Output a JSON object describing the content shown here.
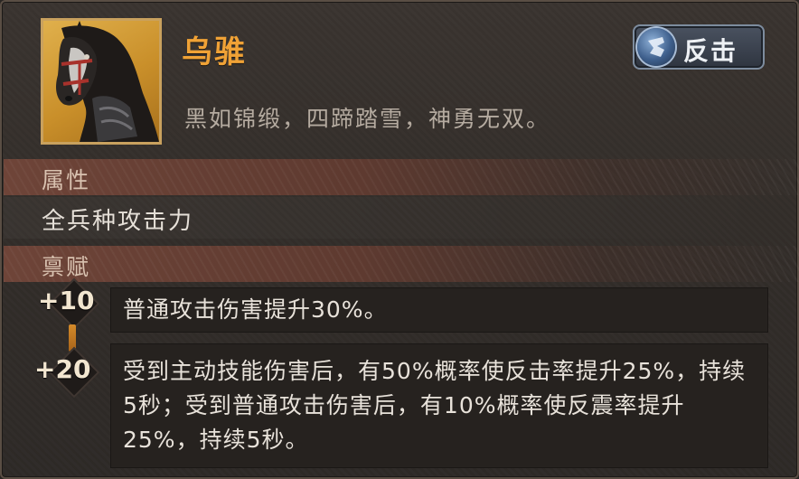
{
  "item": {
    "name": "乌骓",
    "description": "黑如锦缎，四蹄踏雪，神勇无双。",
    "portrait_icon": "black-horse-portrait",
    "type_tag": {
      "label": "反击",
      "icon": "counterattack-icon"
    }
  },
  "sections": {
    "attributes_title": "属性",
    "talent_title": "禀赋"
  },
  "attribute": "全兵种攻击力",
  "talents": [
    {
      "level": "+10",
      "text": "普通攻击伤害提升30%。"
    },
    {
      "level": "+20",
      "text": "受到主动技能伤害后，有50%概率使反击率提升25%，持续5秒；受到普通攻击伤害后，有10%概率使反震率提升25%，持续5秒。"
    }
  ],
  "colors": {
    "name": "#f0a236",
    "section_bar": "#6e4438",
    "text": "#e8e2da",
    "portrait_bg": "#d9a33f"
  }
}
